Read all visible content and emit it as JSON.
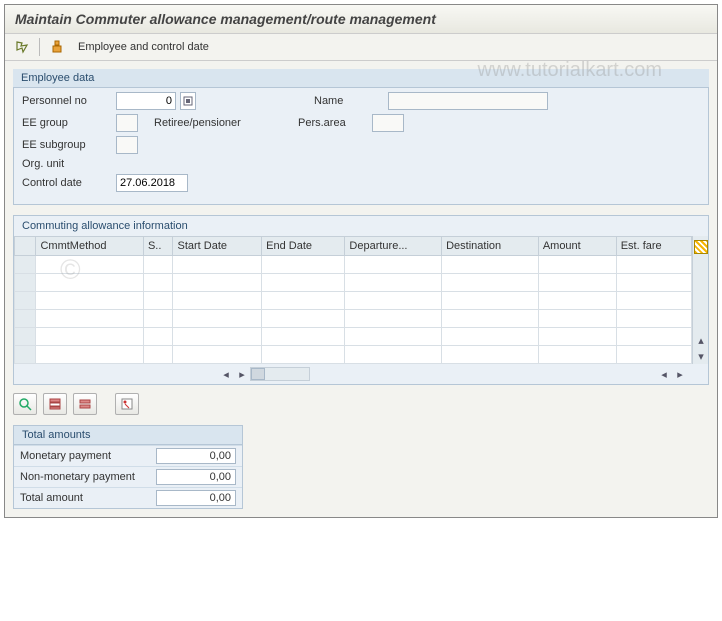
{
  "title": "Maintain Commuter allowance management/route management",
  "toolbar": {
    "emp_control_label": "Employee and control date"
  },
  "employee_data": {
    "legend": "Employee data",
    "personnel_no_label": "Personnel no",
    "personnel_no_value": "0",
    "name_label": "Name",
    "name_value": "",
    "ee_group_label": "EE group",
    "ee_group_value": "",
    "ee_group_text": "Retiree/pensioner",
    "pers_area_label": "Pers.area",
    "pers_area_value": "",
    "ee_subgroup_label": "EE subgroup",
    "ee_subgroup_value": "",
    "org_unit_label": "Org. unit",
    "control_date_label": "Control date",
    "control_date_value": "27.06.2018"
  },
  "allowance_table": {
    "title": "Commuting allowance information",
    "columns": [
      "CmmtMethod",
      "S..",
      "Start Date",
      "End Date",
      "Departure...",
      "Destination",
      "Amount",
      "Est. fare"
    ],
    "rows": [
      [
        "",
        "",
        "",
        "",
        "",
        "",
        "",
        ""
      ],
      [
        "",
        "",
        "",
        "",
        "",
        "",
        "",
        ""
      ],
      [
        "",
        "",
        "",
        "",
        "",
        "",
        "",
        ""
      ],
      [
        "",
        "",
        "",
        "",
        "",
        "",
        "",
        ""
      ],
      [
        "",
        "",
        "",
        "",
        "",
        "",
        "",
        ""
      ],
      [
        "",
        "",
        "",
        "",
        "",
        "",
        "",
        ""
      ]
    ]
  },
  "totals": {
    "legend": "Total amounts",
    "monetary_label": "Monetary payment",
    "monetary_value": "0,00",
    "nonmonetary_label": "Non-monetary payment",
    "nonmonetary_value": "0,00",
    "total_label": "Total amount",
    "total_value": "0,00"
  },
  "watermark": "www.tutorialkart.com",
  "copyright": "©"
}
